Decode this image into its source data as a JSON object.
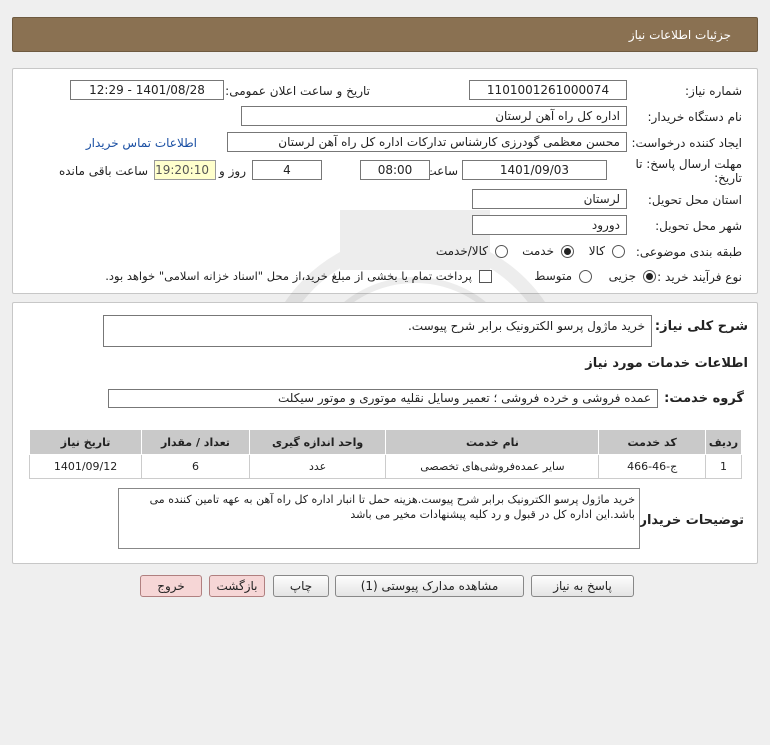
{
  "header": {
    "title": "جزئیات اطلاعات نیاز"
  },
  "fields": {
    "need_number_label": "شماره نیاز:",
    "need_number": "1101001261000074",
    "announce_label": "تاریخ و ساعت اعلان عمومی:",
    "announce_value": "1401/08/28 - 12:29",
    "buyer_org_label": "نام دستگاه خریدار:",
    "buyer_org": "اداره کل راه آهن لرستان",
    "creator_label": "ایجاد کننده درخواست:",
    "creator": "محسن معظمی گودرزی کارشناس تدارکات اداره کل راه آهن لرستان",
    "contact_link": "اطلاعات تماس خریدار",
    "deadline_label": "مهلت ارسال پاسخ: تا تاریخ:",
    "deadline_date": "1401/09/03",
    "hour_label": "ساعت",
    "deadline_time": "08:00",
    "days": "4",
    "days_label": "روز و",
    "remaining_time": "19:20:10",
    "remaining_label": "ساعت باقی مانده",
    "province_label": "استان محل تحویل:",
    "province": "لرستان",
    "city_label": "شهر محل تحویل:",
    "city": "دورود",
    "category_label": "طبقه بندی موضوعی:",
    "category_options": [
      "کالا",
      "خدمت",
      "کالا/خدمت"
    ],
    "process_label": "نوع فرآیند خرید :",
    "process_options": [
      "جزیی",
      "متوسط"
    ],
    "payment_note": "پرداخت تمام یا بخشی از مبلغ خرید،از محل \"اسناد خزانه اسلامی\" خواهد بود."
  },
  "summary": {
    "label": "شرح کلی نیاز:",
    "value": "خرید ماژول پرسو الکترونیک برابر شرح پیوست."
  },
  "services": {
    "section_title": "اطلاعات خدمات مورد نیاز",
    "group_label": "گروه خدمت:",
    "group_value": "عمده فروشی و خرده فروشی ؛ تعمیر وسایل نقلیه موتوری و موتور سیکلت",
    "columns": [
      "ردیف",
      "کد خدمت",
      "نام خدمت",
      "واحد اندازه گیری",
      "تعداد / مقدار",
      "تاریخ نیاز"
    ],
    "rows": [
      [
        "1",
        "ج-46-466",
        "سایر عمده‌فروشی‌های تخصصی",
        "عدد",
        "6",
        "1401/09/12"
      ]
    ]
  },
  "buyer_notes": {
    "label": "توضیحات خریدار:",
    "value": "خرید ماژول پرسو الکترونیک برابر شرح پیوست.هزینه حمل تا انبار اداره کل راه آهن به عهه تامین کننده می باشد.این اداره کل در قبول و رد کلیه پیشنهادات مخیر می باشد"
  },
  "buttons": {
    "reply": "پاسخ به نیاز",
    "attachments": "مشاهده مدارک پیوستی (1)",
    "print": "چاپ",
    "back": "بازگشت",
    "exit": "خروج"
  },
  "colors": {
    "header": "#8a7152",
    "table_header": "#c9c9c9",
    "link": "#1a4fa3"
  }
}
